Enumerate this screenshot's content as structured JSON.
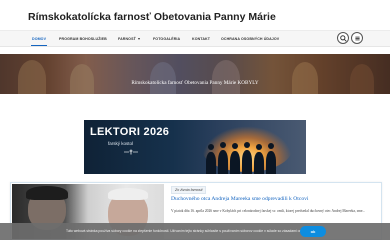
{
  "site": {
    "title": "Rímskokatolícka farnosť Obetovania Panny Márie"
  },
  "nav": {
    "items": [
      {
        "label": "DOMOV",
        "active": true
      },
      {
        "label": "PROGRAM BOHOSLUŽIEB"
      },
      {
        "label": "FARNOSŤ",
        "has_dropdown": true
      },
      {
        "label": "FOTOGALÉRIA"
      },
      {
        "label": "KONTAKT"
      },
      {
        "label": "OCHRANA OSOBNÝCH ÚDAJOV"
      }
    ],
    "icons": [
      "search-icon",
      "menu-icon"
    ]
  },
  "hero": {
    "text": "Rímskokatolícka farnosť Obetovania Panny Márie KOBYLY"
  },
  "banner": {
    "title": "LEKTORI 2026",
    "subtitle": "farský kostol"
  },
  "article": {
    "tag": "Zo života farnosti",
    "title": "Duchovného otca Andreja Mareeka sme odprevadili k Otcovi",
    "excerpt": "V piatok dňa 16. apríla 2026 sme v Kobylách pri celonárodnej farskej sv. omši, ktorej predsedal duchovný otec Andrej Mareeka, sme..."
  },
  "cookie_bar": {
    "text": "Táto webová stránka používa súbory cookie na zlepšenie funkčnosti. Užívaním tejto stránky súhlasíte s používaním súborov cookie v súlade so zásadami ochrany súkromia.",
    "button_label": "ok"
  },
  "colors": {
    "accent": "#1565c0",
    "cookie_button": "#0d8de0"
  }
}
